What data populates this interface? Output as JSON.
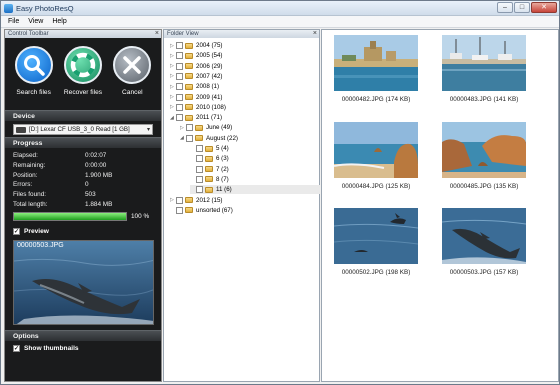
{
  "window": {
    "title": "Easy PhotoResQ",
    "minimize": "–",
    "maximize": "□",
    "close": "✕"
  },
  "menu": [
    "File",
    "View",
    "Help"
  ],
  "toolbar": {
    "panel_title": "Control Toolbar",
    "close_glyph": "×",
    "buttons": [
      {
        "name": "search-files-button",
        "label": "Search files",
        "icon": "magnifier-icon"
      },
      {
        "name": "recover-files-button",
        "label": "Recover files",
        "icon": "lifebuoy-icon"
      },
      {
        "name": "cancel-button",
        "label": "Cancel",
        "icon": "cancel-x-icon"
      }
    ],
    "device_heading": "Device",
    "device_value": "[D:] Lexar   CF  USB_3_0 Read [1 GB]",
    "dropdown_arrow": "▾",
    "progress_heading": "Progress",
    "stats": [
      {
        "label": "Elapsed:",
        "value": "0:02:07"
      },
      {
        "label": "Remaining:",
        "value": "0:00:00"
      },
      {
        "label": "Position:",
        "value": "1.900 MB"
      },
      {
        "label": "Errors:",
        "value": "0"
      },
      {
        "label": "Files found:",
        "value": "503"
      },
      {
        "label": "Total length:",
        "value": "1.884 MB"
      }
    ],
    "progress_percent": 100,
    "progress_label": "100 %",
    "preview_label": "Preview",
    "preview_checked": "✓",
    "preview_filename": "00000503.JPG",
    "options_heading": "Options",
    "show_thumbnails_label": "Show thumbnails",
    "show_thumbnails_checked": "✓"
  },
  "folder_view": {
    "panel_title": "Folder View",
    "close_glyph": "×",
    "expand_collapsed": "▷",
    "expand_open": "◢",
    "items": [
      {
        "label": "2004 (75)",
        "level": 0,
        "expand": "collapsed"
      },
      {
        "label": "2005 (54)",
        "level": 0,
        "expand": "collapsed"
      },
      {
        "label": "2006 (29)",
        "level": 0,
        "expand": "collapsed"
      },
      {
        "label": "2007 (42)",
        "level": 0,
        "expand": "collapsed"
      },
      {
        "label": "2008 (1)",
        "level": 0,
        "expand": "collapsed"
      },
      {
        "label": "2009 (41)",
        "level": 0,
        "expand": "collapsed"
      },
      {
        "label": "2010 (108)",
        "level": 0,
        "expand": "collapsed"
      },
      {
        "label": "2011 (71)",
        "level": 0,
        "expand": "open"
      },
      {
        "label": "June (49)",
        "level": 1,
        "expand": "collapsed"
      },
      {
        "label": "August (22)",
        "level": 1,
        "expand": "open"
      },
      {
        "label": "5 (4)",
        "level": 2,
        "expand": "none"
      },
      {
        "label": "6 (3)",
        "level": 2,
        "expand": "none"
      },
      {
        "label": "7 (2)",
        "level": 2,
        "expand": "none"
      },
      {
        "label": "8 (7)",
        "level": 2,
        "expand": "none"
      },
      {
        "label": "11 (6)",
        "level": 2,
        "expand": "none",
        "selected": true
      },
      {
        "label": "2012 (15)",
        "level": 0,
        "expand": "collapsed"
      },
      {
        "label": "unsorted (67)",
        "level": 0,
        "expand": "none"
      }
    ]
  },
  "thumbnails": [
    {
      "caption": "00000482.JPG (174 KB)",
      "scene": "castle"
    },
    {
      "caption": "00000483.JPG (141 KB)",
      "scene": "harbor"
    },
    {
      "caption": "00000484.JPG (125 KB)",
      "scene": "beach-rock"
    },
    {
      "caption": "00000485.JPG (135 KB)",
      "scene": "cliffs"
    },
    {
      "caption": "00000502.JPG (198 KB)",
      "scene": "dolphin-far"
    },
    {
      "caption": "00000503.JPG (157 KB)",
      "scene": "dolphin-jump"
    }
  ],
  "colors": {
    "panel_bg": "#1a1b1c",
    "progress": "#2fb52f",
    "accent_blue": "#0b62c8"
  }
}
